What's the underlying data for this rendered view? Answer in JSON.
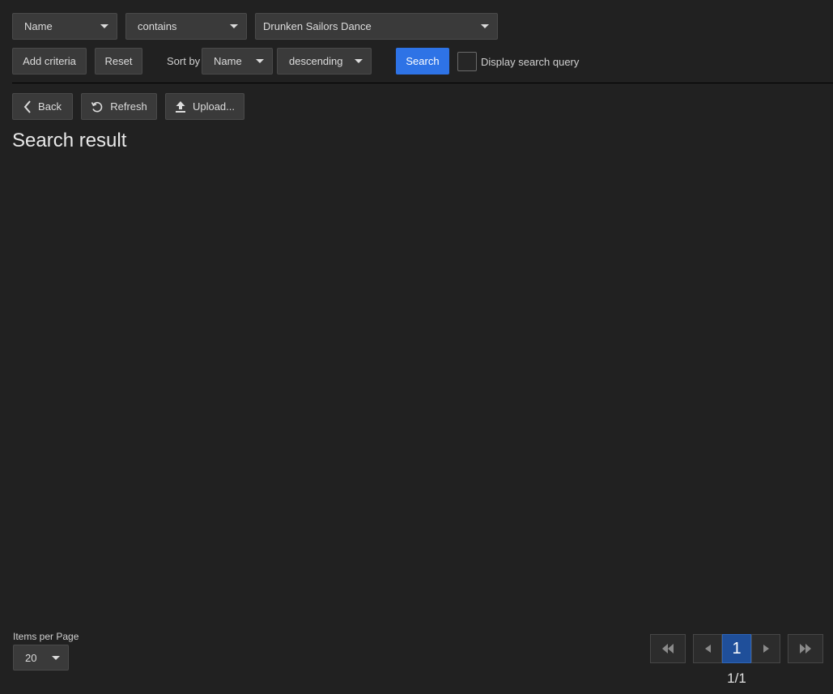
{
  "criteria": {
    "field": "Name",
    "operator": "contains",
    "value": "Drunken Sailors Dance"
  },
  "toolbar": {
    "add_criteria": "Add criteria",
    "reset": "Reset",
    "sort_by_label": "Sort by",
    "sort_field": "Name",
    "sort_order": "descending",
    "search": "Search",
    "display_query_label": "Display search query",
    "display_query_checked": false
  },
  "actions": {
    "back": "Back",
    "refresh": "Refresh",
    "upload": "Upload..."
  },
  "results": {
    "title": "Search result"
  },
  "footer": {
    "items_per_page_label": "Items per Page",
    "items_per_page_value": "20",
    "current_page": "1",
    "page_status": "1/1"
  },
  "colors": {
    "background": "#212121",
    "primary": "#2e73e6",
    "active_page": "#1f4f9a"
  }
}
